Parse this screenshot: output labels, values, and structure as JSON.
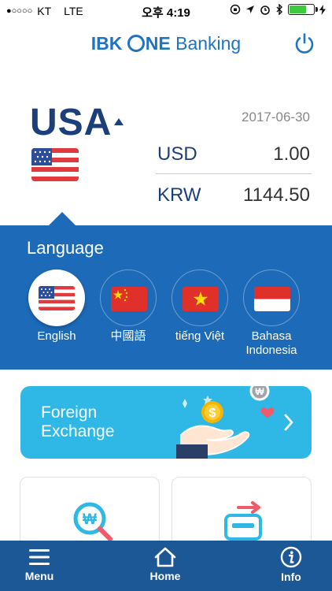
{
  "status_bar": {
    "signal": "●○○○○",
    "carrier": "KT",
    "network": "LTE",
    "time": "오후 4:19",
    "battery_level": 0.7,
    "colors": {
      "battery": "#3ccb3c"
    }
  },
  "header": {
    "logo_ibk": "IBK",
    "logo_ne": "NE",
    "logo_banking": "Banking",
    "power_icon": "power-icon"
  },
  "currency": {
    "country": "USA",
    "date": "2017-06-30",
    "rows": [
      {
        "code": "USD",
        "value": "1.00"
      },
      {
        "code": "KRW",
        "value": "1144.50"
      }
    ]
  },
  "language": {
    "title": "Language",
    "items": [
      {
        "label": "English",
        "flag": "us-flag",
        "active": true
      },
      {
        "label": "中國語",
        "flag": "china-flag",
        "active": false
      },
      {
        "label": "tiếng Việt",
        "flag": "vietnam-flag",
        "active": false
      },
      {
        "label_line1": "Bahasa",
        "label_line2": "Indonesia",
        "flag": "indonesia-flag",
        "active": false
      }
    ]
  },
  "fx_banner": {
    "line1": "Foreign",
    "line2": "Exchange",
    "coin_symbol": "$",
    "won_symbol": "₩"
  },
  "cards": [
    {
      "icon": "won-search-icon"
    },
    {
      "icon": "exchange-machine-icon"
    }
  ],
  "bottom_nav": [
    {
      "label": "Menu",
      "icon": "menu-icon"
    },
    {
      "label": "Home",
      "icon": "home-icon"
    },
    {
      "label": "Info",
      "icon": "info-icon"
    }
  ],
  "colors": {
    "brand_blue": "#1e73c2",
    "panel_blue": "#1c6ab8",
    "nav_blue": "#1c5796",
    "banner_cyan": "#2fb7e6",
    "text_navy": "#1b3f7a"
  }
}
